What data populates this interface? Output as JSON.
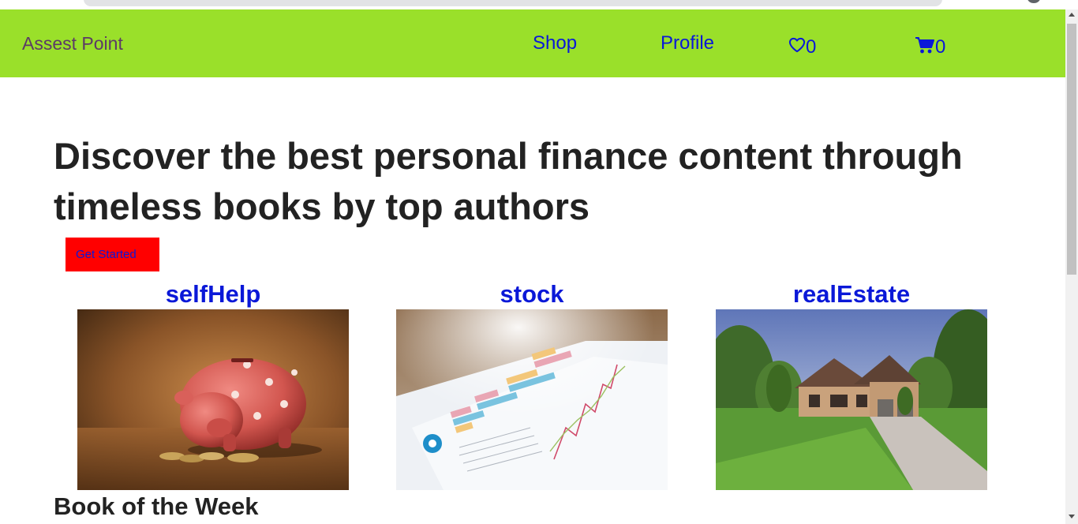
{
  "navbar": {
    "brand": "Assest Point",
    "links": [
      {
        "label": "Shop"
      },
      {
        "label": "Profile"
      }
    ],
    "wishlist_count": "0",
    "cart_count": "0",
    "background": "#9ae02a",
    "link_color": "#0a18d8",
    "icons": [
      "heart-icon",
      "cart-icon"
    ]
  },
  "hero": {
    "title": "Discover the best personal finance content through timeless books by top authors",
    "cta_label": "Get Started",
    "cta_color": "#ff0000"
  },
  "categories": [
    {
      "label": "selfHelp",
      "image": "piggy-bank-photo"
    },
    {
      "label": "stock",
      "image": "stock-chart-photo"
    },
    {
      "label": "realEstate",
      "image": "house-photo"
    }
  ],
  "sections": {
    "book_of_week": "Book of the Week"
  }
}
